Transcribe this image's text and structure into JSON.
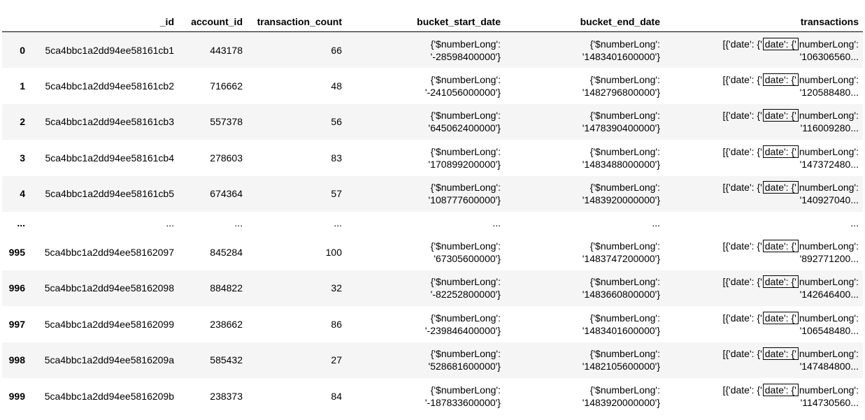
{
  "columns": [
    "",
    "_id",
    "account_id",
    "transaction_count",
    "bucket_start_date",
    "bucket_end_date",
    "transactions"
  ],
  "ellipsis": "...",
  "rows": [
    {
      "index": "0",
      "id": "5ca4bbc1a2dd94ee58161cb1",
      "account_id": "443178",
      "transaction_count": "66",
      "start_l1": "{'$numberLong':",
      "start_l2": "'-28598400000'}",
      "end_l1": "{'$numberLong':",
      "end_l2": "'1483401600000'}",
      "tx_a": "[{'date': {'",
      "tx_box": "date': {'",
      "tx_b": "numberLong':",
      "tx_l2": "'106306560..."
    },
    {
      "index": "1",
      "id": "5ca4bbc1a2dd94ee58161cb2",
      "account_id": "716662",
      "transaction_count": "48",
      "start_l1": "{'$numberLong':",
      "start_l2": "'-241056000000'}",
      "end_l1": "{'$numberLong':",
      "end_l2": "'1482796800000'}",
      "tx_a": "[{'date': {'",
      "tx_box": "date': {'",
      "tx_b": "numberLong':",
      "tx_l2": "'120588480..."
    },
    {
      "index": "2",
      "id": "5ca4bbc1a2dd94ee58161cb3",
      "account_id": "557378",
      "transaction_count": "56",
      "start_l1": "{'$numberLong':",
      "start_l2": "'645062400000'}",
      "end_l1": "{'$numberLong':",
      "end_l2": "'1478390400000'}",
      "tx_a": "[{'date': {'",
      "tx_box": "date': {'",
      "tx_b": "numberLong':",
      "tx_l2": "'116009280..."
    },
    {
      "index": "3",
      "id": "5ca4bbc1a2dd94ee58161cb4",
      "account_id": "278603",
      "transaction_count": "83",
      "start_l1": "{'$numberLong':",
      "start_l2": "'170899200000'}",
      "end_l1": "{'$numberLong':",
      "end_l2": "'1483488000000'}",
      "tx_a": "[{'date': {'",
      "tx_box": "date': {'",
      "tx_b": "numberLong':",
      "tx_l2": "'147372480..."
    },
    {
      "index": "4",
      "id": "5ca4bbc1a2dd94ee58161cb5",
      "account_id": "674364",
      "transaction_count": "57",
      "start_l1": "{'$numberLong':",
      "start_l2": "'108777600000'}",
      "end_l1": "{'$numberLong':",
      "end_l2": "'1483920000000'}",
      "tx_a": "[{'date': {'",
      "tx_box": "date': {'",
      "tx_b": "numberLong':",
      "tx_l2": "'140927040..."
    },
    {
      "ellipsis": true
    },
    {
      "index": "995",
      "id": "5ca4bbc1a2dd94ee58162097",
      "account_id": "845284",
      "transaction_count": "100",
      "start_l1": "{'$numberLong':",
      "start_l2": "'67305600000'}",
      "end_l1": "{'$numberLong':",
      "end_l2": "'1483747200000'}",
      "tx_a": "[{'date': {'",
      "tx_box": "date': {'",
      "tx_b": "numberLong':",
      "tx_l2": "'892771200..."
    },
    {
      "index": "996",
      "id": "5ca4bbc1a2dd94ee58162098",
      "account_id": "884822",
      "transaction_count": "32",
      "start_l1": "{'$numberLong':",
      "start_l2": "'-82252800000'}",
      "end_l1": "{'$numberLong':",
      "end_l2": "'1483660800000'}",
      "tx_a": "[{'date': {'",
      "tx_box": "date': {'",
      "tx_b": "numberLong':",
      "tx_l2": "'142646400..."
    },
    {
      "index": "997",
      "id": "5ca4bbc1a2dd94ee58162099",
      "account_id": "238662",
      "transaction_count": "86",
      "start_l1": "{'$numberLong':",
      "start_l2": "'-239846400000'}",
      "end_l1": "{'$numberLong':",
      "end_l2": "'1483401600000'}",
      "tx_a": "[{'date': {'",
      "tx_box": "date': {'",
      "tx_b": "numberLong':",
      "tx_l2": "'106548480..."
    },
    {
      "index": "998",
      "id": "5ca4bbc1a2dd94ee5816209a",
      "account_id": "585432",
      "transaction_count": "27",
      "start_l1": "{'$numberLong':",
      "start_l2": "'528681600000'}",
      "end_l1": "{'$numberLong':",
      "end_l2": "'1482105600000'}",
      "tx_a": "[{'date': {'",
      "tx_box": "date': {'",
      "tx_b": "numberLong':",
      "tx_l2": "'147484800..."
    },
    {
      "index": "999",
      "id": "5ca4bbc1a2dd94ee5816209b",
      "account_id": "238373",
      "transaction_count": "84",
      "start_l1": "{'$numberLong':",
      "start_l2": "'-187833600000'}",
      "end_l1": "{'$numberLong':",
      "end_l2": "'1483920000000'}",
      "tx_a": "[{'date': {'",
      "tx_box": "date': {'",
      "tx_b": "numberLong':",
      "tx_l2": "'114730560..."
    }
  ]
}
